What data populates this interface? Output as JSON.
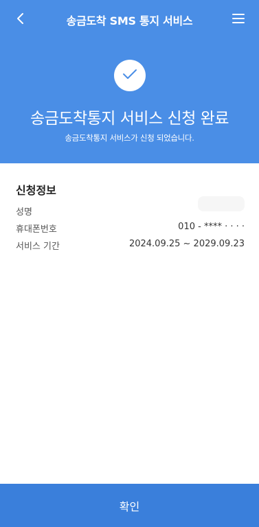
{
  "header": {
    "title": "송금도착 SMS 통지 서비스",
    "back_icon": "chevron-left-icon",
    "menu_icon": "hamburger-menu-icon"
  },
  "hero": {
    "check_icon": "check-icon",
    "title": "송금도착통지 서비스 신청 완료",
    "subtitle": "송금도착통지 서비스가 신청 되었습니다."
  },
  "info": {
    "section_title": "신청정보",
    "rows": [
      {
        "label": "성명",
        "value": ""
      },
      {
        "label": "휴대폰번호",
        "value": "010 - **** · · · ·"
      },
      {
        "label": "서비스 기간",
        "value": "2024.09.25 ~ 2029.09.23"
      }
    ]
  },
  "footer": {
    "confirm_label": "확인"
  },
  "colors": {
    "primary": "#4a8ee6",
    "button": "#3a7fdb",
    "check": "#4a8ee6"
  }
}
